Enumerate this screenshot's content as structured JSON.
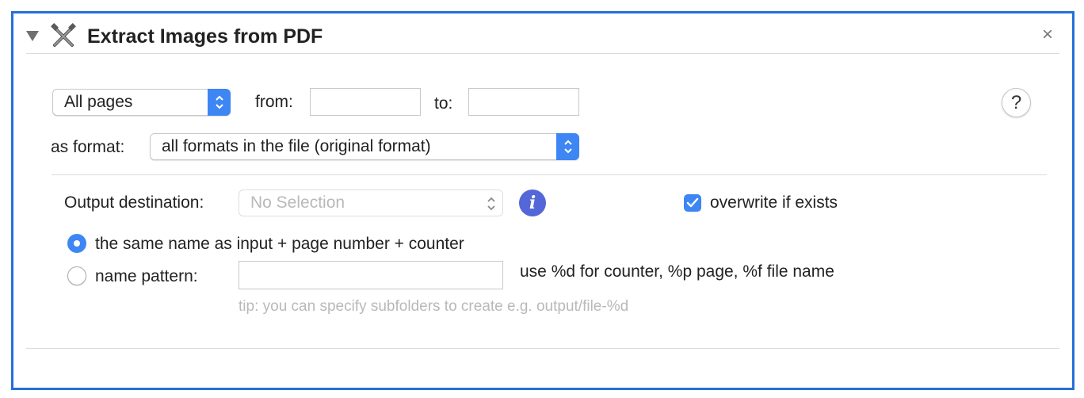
{
  "header": {
    "title": "Extract Images from PDF",
    "close_glyph": "×",
    "collapse_icon": "disclosure-triangle-icon",
    "action_icon": "tools-icon"
  },
  "pages": {
    "range_selected": "All pages",
    "from_label": "from:",
    "from_value": "",
    "to_label": "to:",
    "to_value": ""
  },
  "help_glyph": "?",
  "format": {
    "label": "as format:",
    "selected": "all formats in the file (original format)"
  },
  "output": {
    "label": "Output destination:",
    "placeholder": "No Selection",
    "info_glyph": "i",
    "overwrite_label": "overwrite if exists",
    "overwrite_checked": true
  },
  "naming": {
    "option1_label": "the same name as input + page number + counter",
    "option1_selected": true,
    "option2_label": "name pattern:",
    "option2_selected": false,
    "pattern_value": "",
    "pattern_hint": "use %d for counter, %p page, %f file name",
    "tip": "tip: you can specify subfolders to create e.g. output/file-%d"
  },
  "colors": {
    "accent": "#3d86f4",
    "frame_border": "#2670d8",
    "info_badge": "#5467d8"
  }
}
